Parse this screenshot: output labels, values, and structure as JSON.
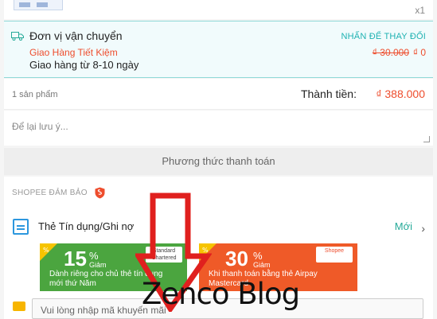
{
  "product": {
    "quantity": "x1"
  },
  "shipping": {
    "title": "Đơn vị vận chuyển",
    "change_label": "NHẤN ĐỂ THAY ĐỔI",
    "method": "Giao Hàng Tiết Kiệm",
    "old_fee": "₫ 30.000",
    "new_fee": "₫ 0",
    "eta": "Giao hàng từ 8-10 ngày"
  },
  "summary": {
    "count": "1 sản phẩm",
    "total_label": "Thành tiền:",
    "total_value": "₫ 388.000"
  },
  "note": {
    "placeholder": "Để lại lưu ý..."
  },
  "payment": {
    "section_title": "Phương thức thanh toán"
  },
  "guarantee": {
    "label": "SHOPEE ĐẢM BẢO"
  },
  "credit": {
    "title": "Thẻ Tín dụng/Ghi nợ",
    "badge": "Mới",
    "chevron": "›",
    "promos": [
      {
        "percent": "15",
        "pct_symbol": "%",
        "discount": "Giảm",
        "desc": "Dành riêng cho chủ thẻ tín dụng mới thứ Năm",
        "logo": "Standard Chartered",
        "color": "#4ba53f"
      },
      {
        "percent": "30",
        "pct_symbol": "%",
        "discount": "Giảm",
        "desc": "Khi thanh toán bằng thẻ Airpay Mastercard",
        "logo": "Shopee",
        "color": "#ef5a28"
      }
    ]
  },
  "voucher": {
    "placeholder": "Vui lòng nhập mã khuyến mãi"
  },
  "watermark": "Zenco Blog",
  "colors": {
    "accent": "#ee4d2d",
    "teal": "#26aa99",
    "arrow": "#e0201e"
  }
}
